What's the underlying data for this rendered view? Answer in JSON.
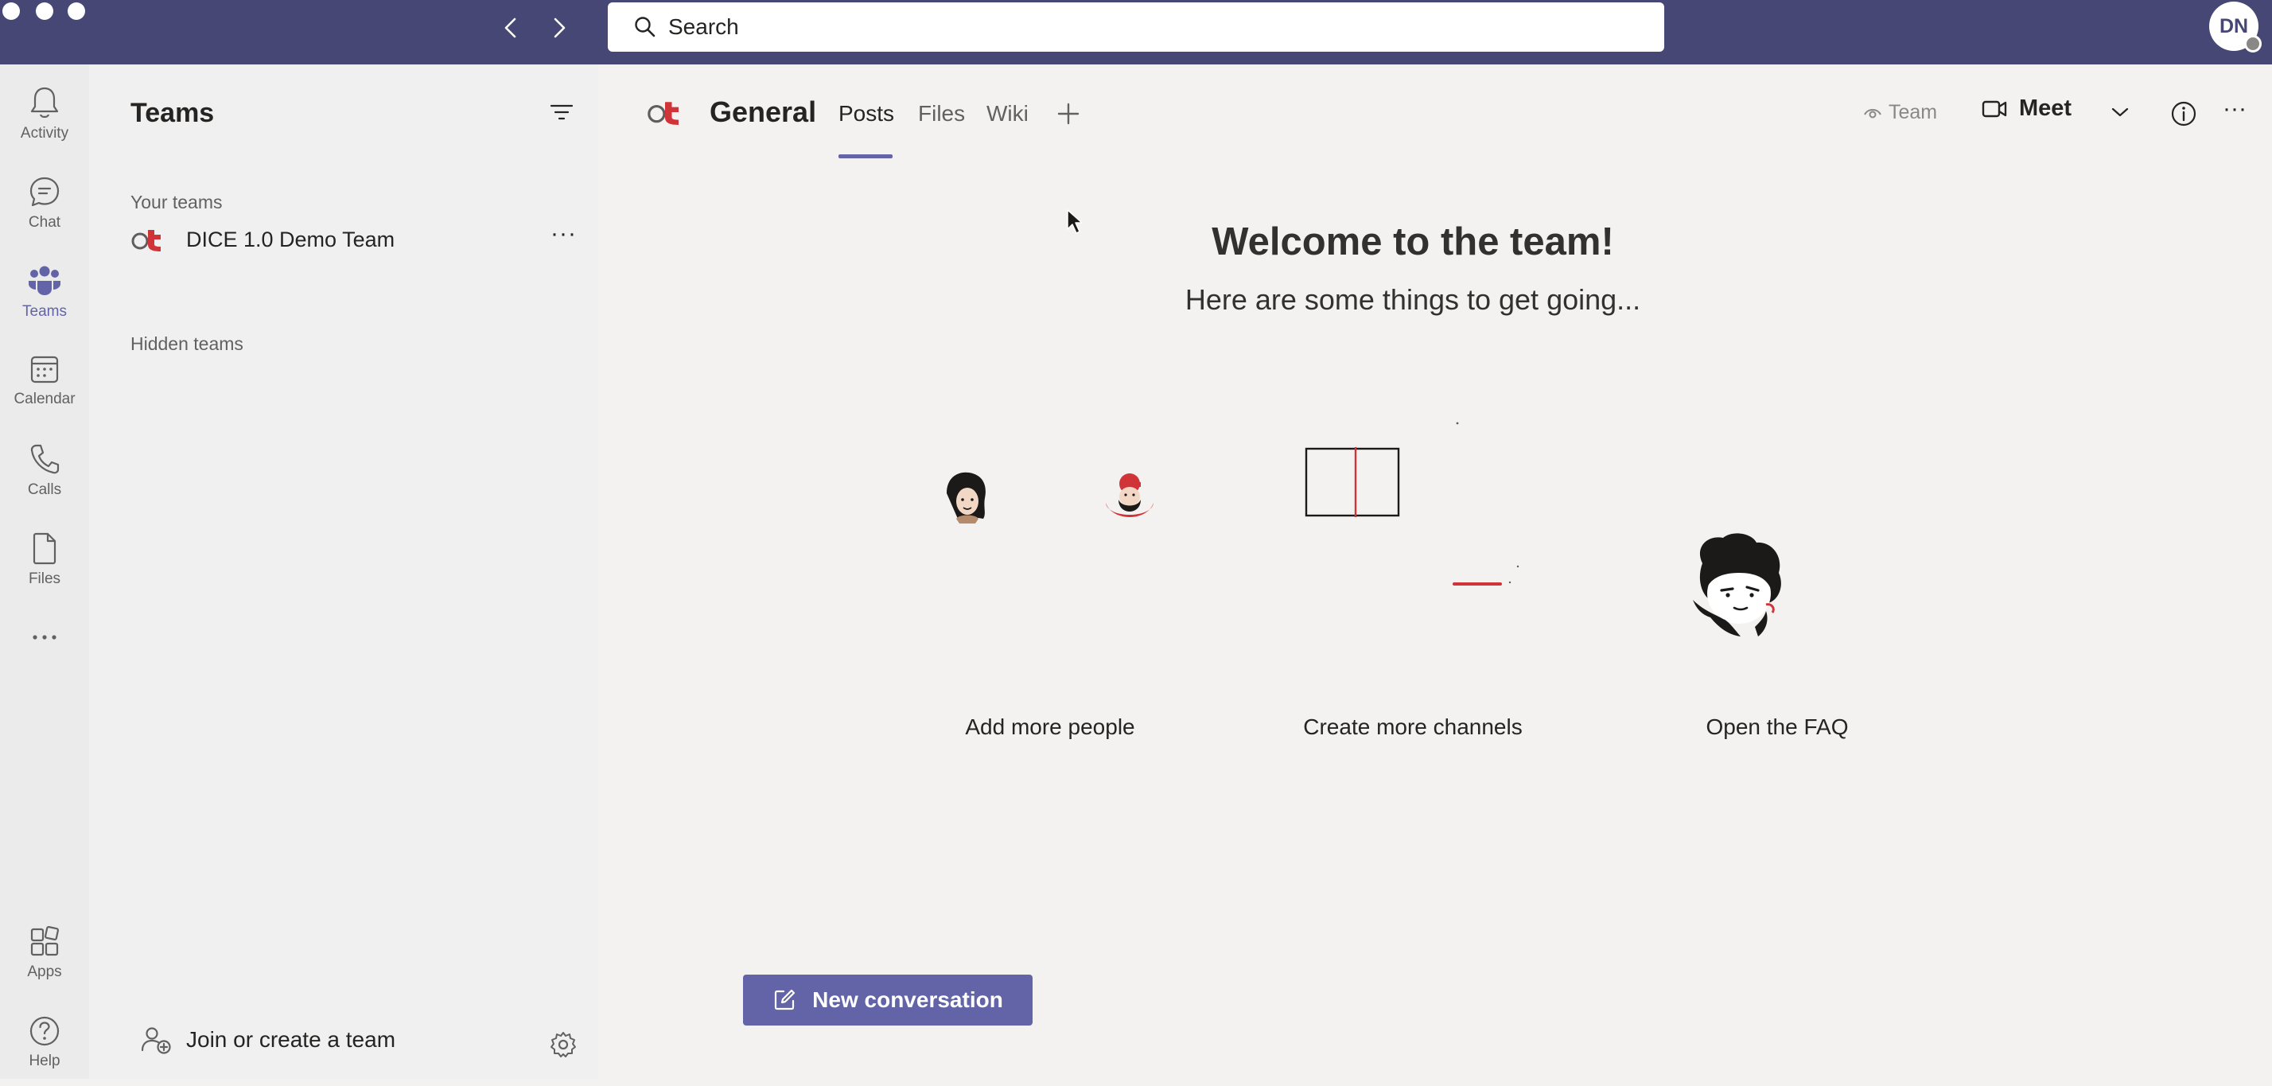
{
  "window": {
    "search_placeholder": "Search",
    "avatar_initials": "DN"
  },
  "rail": {
    "items": [
      {
        "label": "Activity",
        "icon": "bell-icon"
      },
      {
        "label": "Chat",
        "icon": "chat-icon"
      },
      {
        "label": "Teams",
        "icon": "teams-icon",
        "active": true
      },
      {
        "label": "Calendar",
        "icon": "calendar-icon"
      },
      {
        "label": "Calls",
        "icon": "phone-icon"
      },
      {
        "label": "Files",
        "icon": "file-icon"
      },
      {
        "label": "",
        "icon": "more-apps-icon"
      }
    ],
    "bottom": [
      {
        "label": "Apps",
        "icon": "apps-icon"
      },
      {
        "label": "Help",
        "icon": "help-icon"
      }
    ]
  },
  "panel": {
    "title": "Teams",
    "your_teams_label": "Your teams",
    "team_name": "DICE 1.0 Demo Team",
    "team_more": "···",
    "hidden_teams_label": "Hidden teams",
    "join_label": "Join or create a team"
  },
  "channel": {
    "name": "General",
    "tabs": [
      "Posts",
      "Files",
      "Wiki"
    ],
    "active_tab": "Posts",
    "team_label": "Team",
    "meet_label": "Meet",
    "more": "···"
  },
  "welcome": {
    "title": "Welcome to the team!",
    "subtitle": "Here are some things to get going...",
    "cards": [
      "Add more people",
      "Create more channels",
      "Open the FAQ"
    ]
  },
  "actions": {
    "new_conversation": "New conversation"
  },
  "colors": {
    "titlebar": "#464775",
    "accent": "#6264a7",
    "brand_red": "#d13438"
  }
}
